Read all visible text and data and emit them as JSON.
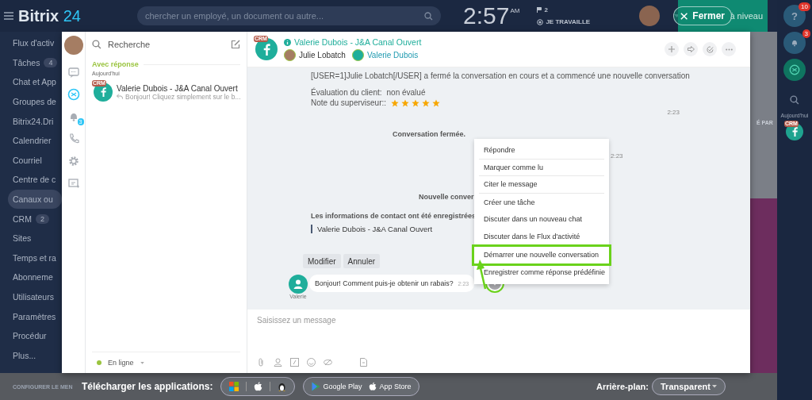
{
  "top_bar": {
    "logo": {
      "name": "Bitrix",
      "suffix": "24"
    },
    "search": {
      "placeholder": "chercher un employé, un document ou autre..."
    },
    "clock": {
      "time": "2:57",
      "period": "AM"
    },
    "flag_count": "2",
    "status": "JE TRAVAILLE",
    "close_button": "Fermer",
    "upgrade": "à niveau"
  },
  "left_menu": [
    {
      "label": "Flux d'activ",
      "selected": false
    },
    {
      "label": "Tâches",
      "badge": "4",
      "selected": false
    },
    {
      "label": "Chat et App",
      "selected": false
    },
    {
      "label": "Groupes de",
      "selected": false
    },
    {
      "label": "Bitrix24.Dri",
      "selected": false
    },
    {
      "label": "Calendrier",
      "selected": false
    },
    {
      "label": "Courriel",
      "selected": false
    },
    {
      "label": "Centre de c",
      "selected": false
    },
    {
      "label": "Canaux ou",
      "selected": true
    },
    {
      "label": "CRM",
      "badge": "2",
      "selected": false
    },
    {
      "label": "Sites",
      "selected": false
    },
    {
      "label": "Temps et ra",
      "selected": false
    },
    {
      "label": "Abonneme",
      "selected": false
    },
    {
      "label": "Utilisateurs",
      "selected": false
    },
    {
      "label": "Paramètres",
      "selected": false
    },
    {
      "label": "Procédur",
      "selected": false
    },
    {
      "label": "Plus...",
      "selected": false
    }
  ],
  "right_bar": {
    "help_icon": "?",
    "help_badge": "10",
    "bell_badge": "3",
    "background_text": "É PAR",
    "today": "Aujourd'hui",
    "avatar_badge": "CRM"
  },
  "messenger": {
    "rail": [
      {
        "kind": "chat",
        "selected": false
      },
      {
        "kind": "openlines",
        "selected": true
      },
      {
        "kind": "notifications",
        "selected": false,
        "badge": "3"
      },
      {
        "kind": "phone",
        "selected": false
      },
      {
        "kind": "settings",
        "selected": false
      },
      {
        "kind": "calendar",
        "selected": false
      }
    ],
    "recent": {
      "search": {
        "placeholder": "Recherche"
      },
      "group": "Avec réponse",
      "date": "Aujourd'hui",
      "items": [
        {
          "badge": "CRM",
          "title": "Valerie Dubois - J&A Canal Ouvert",
          "preview": "Bonjour! Cliquez simplement sur le b...",
          "selected": false
        }
      ],
      "status": "En ligne"
    },
    "chat": {
      "badge": "CRM",
      "title": "Valerie Dubois - J&A Canal Ouvert",
      "members": [
        "Julie Lobatch",
        "Valerie Dubois"
      ],
      "body": [
        {
          "kind": "system",
          "text": "[USER=1]Julie Lobatch[/USER] a fermé la conversation en cours et a commencé une nouvelle conversation"
        },
        {
          "kind": "field",
          "label": "Évaluation du client:",
          "value": "non évalué"
        },
        {
          "kind": "rating",
          "label": "Note du superviseur::",
          "stars": 5
        },
        {
          "kind": "time",
          "text": "2:23"
        },
        {
          "kind": "notice",
          "text": "Conversation fermée."
        },
        {
          "kind": "side_time",
          "text": "2:23"
        },
        {
          "kind": "notice",
          "text": "Nouvelle conver"
        },
        {
          "kind": "contact",
          "text": "Les informations de contact ont été enregistrées",
          "name": "Valerie Dubois - J&A Canal Ouvert"
        },
        {
          "kind": "actions",
          "buttons": [
            "Modifier",
            "Annuler"
          ]
        },
        {
          "kind": "incoming",
          "author": "Valerie",
          "text": "Bonjour! Comment puis-je obtenir un rabais?",
          "time": "2:23",
          "menu_highlighted": true
        }
      ],
      "input": {
        "placeholder": "Saisissez un message"
      }
    },
    "context_menu": [
      {
        "label": "Répondre",
        "highlighted": false
      },
      {
        "label": "Marquer comme lu",
        "highlighted": false
      },
      {
        "label": "Citer le message",
        "highlighted": false
      },
      {
        "label": "Créer une tâche",
        "highlighted": false
      },
      {
        "label": "Discuter dans un nouveau chat",
        "highlighted": false
      },
      {
        "label": "Discuter dans le Flux d'activité",
        "highlighted": false
      },
      {
        "label": "Démarrer une nouvelle conversation",
        "highlighted": true
      },
      {
        "label": "Enregistrer comme réponse prédéfinie",
        "highlighted": false
      }
    ]
  },
  "footer": {
    "configure": "CONFIGURER LE MEN",
    "download_label": "Télécharger les applications:",
    "stores": [
      "Google Play",
      "App Store"
    ],
    "background_label": "Arrière-plan:",
    "background_value": "Transparent"
  }
}
